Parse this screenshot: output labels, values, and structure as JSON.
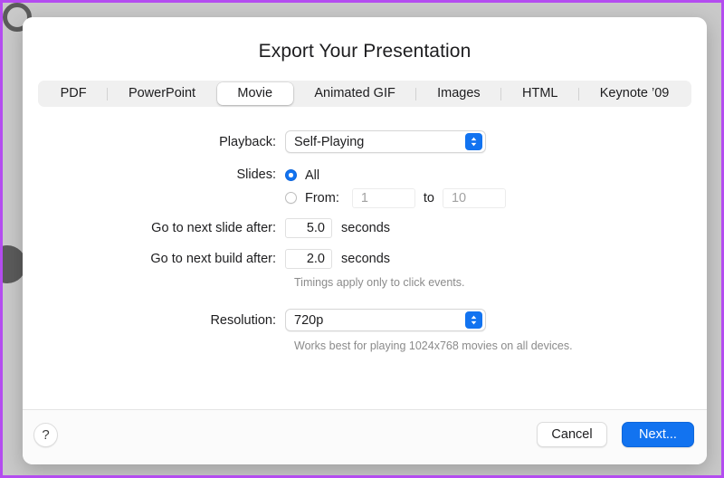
{
  "window": {
    "title": "Export Your Presentation"
  },
  "tabs": [
    {
      "label": "PDF",
      "selected": false
    },
    {
      "label": "PowerPoint",
      "selected": false
    },
    {
      "label": "Movie",
      "selected": true
    },
    {
      "label": "Animated GIF",
      "selected": false
    },
    {
      "label": "Images",
      "selected": false
    },
    {
      "label": "HTML",
      "selected": false
    },
    {
      "label": "Keynote ’09",
      "selected": false
    }
  ],
  "form": {
    "playback": {
      "label": "Playback:",
      "value": "Self-Playing",
      "icon": "chevron-updown-icon"
    },
    "slides": {
      "label": "Slides:",
      "all_option": "All",
      "all_selected": true,
      "from_label": "From:",
      "from_selected": false,
      "from_value": "1",
      "to_label": "to",
      "to_value": "10"
    },
    "next_slide": {
      "label": "Go to next slide after:",
      "value": "5.0",
      "unit": "seconds"
    },
    "next_build": {
      "label": "Go to next build after:",
      "value": "2.0",
      "unit": "seconds"
    },
    "timings_hint": "Timings apply only to click events.",
    "resolution": {
      "label": "Resolution:",
      "value": "720p",
      "icon": "chevron-updown-icon"
    },
    "resolution_hint": "Works best for playing 1024x768 movies on all devices."
  },
  "footer": {
    "help_label": "?",
    "cancel_label": "Cancel",
    "next_label": "Next..."
  },
  "colors": {
    "accent": "#1273f0",
    "frame": "#b44cf0",
    "backdrop": "#c9c9c9",
    "dialog": "#ffffff",
    "hint_text": "#8b8b8b"
  }
}
